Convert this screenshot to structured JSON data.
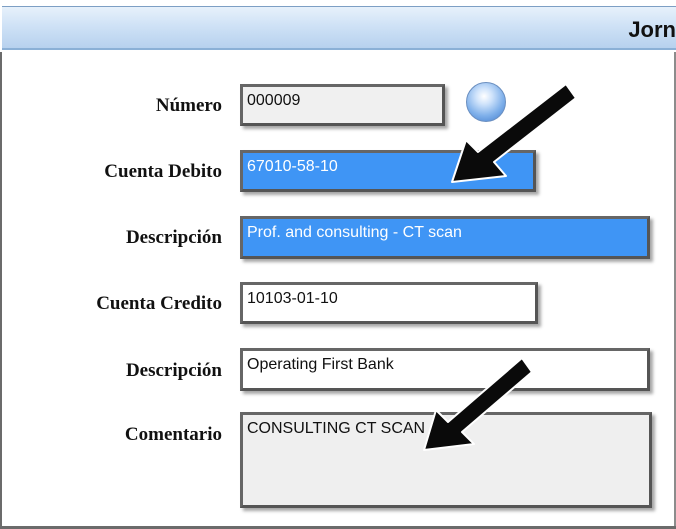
{
  "window": {
    "title": "Jorn"
  },
  "form": {
    "numero": {
      "label": "Número",
      "value": "000009"
    },
    "cuenta_debito": {
      "label": "Cuenta Debito",
      "value": "67010-58-10"
    },
    "descripcion_debito": {
      "label": "Descripción",
      "value": "Prof. and consulting - CT scan"
    },
    "cuenta_credito": {
      "label": "Cuenta Credito",
      "value": "10103-01-10"
    },
    "descripcion_credito": {
      "label": "Descripción",
      "value": "Operating First Bank"
    },
    "comentario": {
      "label": "Comentario",
      "value": "CONSULTING CT SCAN"
    }
  },
  "icons": {
    "lookup": "blue-orb-icon",
    "annotation": "black-arrow-icon"
  },
  "colors": {
    "selection": "#3f95f5",
    "titlebar": "#cfe2f6"
  }
}
